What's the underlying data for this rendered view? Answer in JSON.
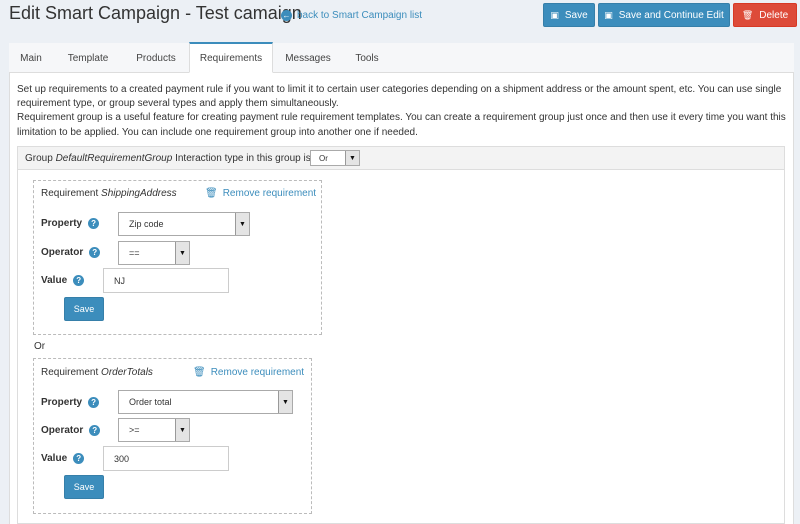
{
  "header": {
    "title": "Edit Smart Campaign - Test camaign",
    "back_link": "back to Smart Campaign list",
    "save_label": "Save",
    "save_continue_label": "Save and Continue Edit",
    "delete_label": "Delete"
  },
  "tabs": [
    {
      "label": "Main"
    },
    {
      "label": "Template"
    },
    {
      "label": "Products"
    },
    {
      "label": "Requirements",
      "active": true
    },
    {
      "label": "Messages"
    },
    {
      "label": "Tools"
    }
  ],
  "description": {
    "para1": "Set up requirements to a created payment rule if you want to limit it to certain user categories depending on a shipment address or the amount spent, etc. You can use single requirement type, or group several types and apply them simultaneously.",
    "para2": "Requirement group is a useful feature for creating payment rule requirement templates. You can create a requirement group just once and then use it every time you want this limitation to be applied. You can include one requirement group into another one if needed."
  },
  "group": {
    "prefix": "Group",
    "name": "DefaultRequirementGroup",
    "interaction_text": "Interaction type in this group is",
    "interaction_value": "Or"
  },
  "or_label": "Or",
  "requirements": [
    {
      "prefix": "Requirement",
      "name": "ShippingAddress",
      "remove_label": "Remove requirement",
      "property_label": "Property",
      "property_value": "Zip code",
      "operator_label": "Operator",
      "operator_value": "==",
      "value_label": "Value",
      "value_value": "NJ",
      "save_label": "Save"
    },
    {
      "prefix": "Requirement",
      "name": "OrderTotals",
      "remove_label": "Remove requirement",
      "property_label": "Property",
      "property_value": "Order total",
      "operator_label": "Operator",
      "operator_value": ">=",
      "value_label": "Value",
      "value_value": "300",
      "save_label": "Save"
    }
  ],
  "colors": {
    "primary": "#3c8dbc",
    "danger": "#dd4b39",
    "background": "#ecf0f5"
  },
  "icons": {
    "back": "arrow-left-circle-icon",
    "save": "floppy-disk-icon",
    "delete": "trash-icon",
    "help": "question-circle-icon",
    "dropdown": "caret-down-icon"
  }
}
